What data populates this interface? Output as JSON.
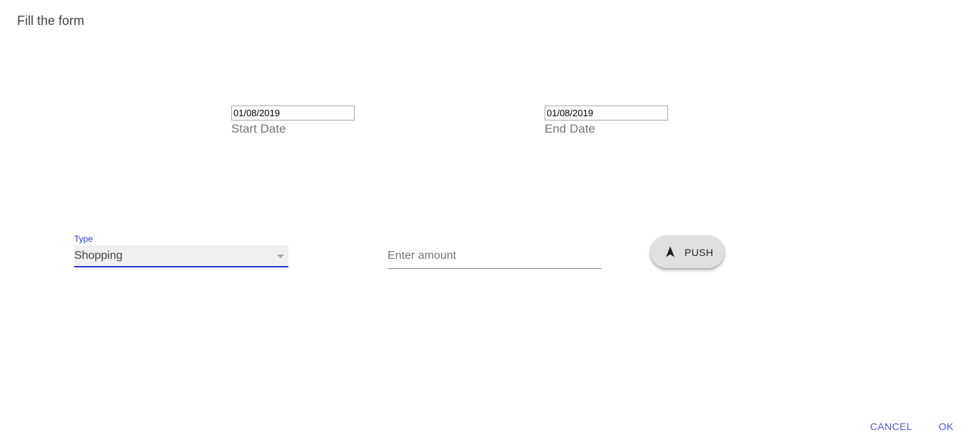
{
  "dialog": {
    "title": "Fill the form"
  },
  "form": {
    "start_date": {
      "value": "01/08/2019",
      "label": "Start Date"
    },
    "end_date": {
      "value": "01/08/2019",
      "label": "End Date"
    },
    "type": {
      "label": "Type",
      "selected": "Shopping"
    },
    "amount": {
      "placeholder": "Enter amount",
      "value": ""
    },
    "push_button": {
      "label": "PUSH",
      "icon": "navigation-arrow-icon"
    }
  },
  "actions": {
    "cancel_label": "CANCEL",
    "ok_label": "OK"
  },
  "colors": {
    "accent": "#1f3ad6",
    "action_text": "#4f5ad8",
    "button_bg": "#e0e0e0"
  }
}
